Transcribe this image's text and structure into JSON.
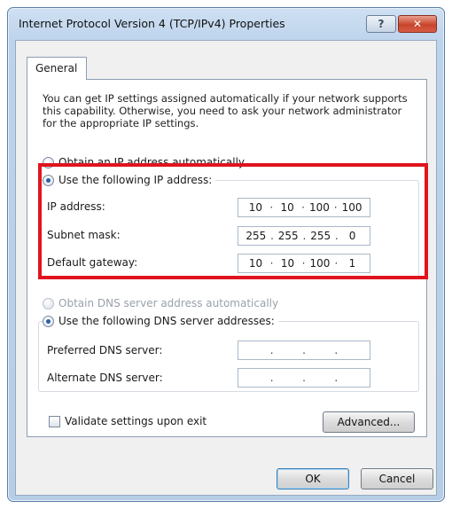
{
  "window": {
    "title": "Internet Protocol Version 4 (TCP/IPv4) Properties",
    "help_label": "?",
    "close_label": "✕"
  },
  "tabs": [
    {
      "label": "General",
      "selected": true
    }
  ],
  "intro_text": "You can get IP settings assigned automatically if your network supports this capability. Otherwise, you need to ask your network administrator for the appropriate IP settings.",
  "ip_section": {
    "auto_label": "Obtain an IP address automatically",
    "manual_label": "Use the following IP address:",
    "selected": "manual",
    "fields": [
      {
        "label": "IP address:",
        "octets": [
          "10",
          "10",
          "100",
          "100"
        ],
        "sep": [
          "·",
          "·",
          "·"
        ]
      },
      {
        "label": "Subnet mask:",
        "octets": [
          "255",
          "255",
          "255",
          "0"
        ],
        "sep": [
          ".",
          ".",
          "."
        ]
      },
      {
        "label": "Default gateway:",
        "octets": [
          "10",
          "10",
          "100",
          "1"
        ],
        "sep": [
          "·",
          "·",
          "·"
        ]
      }
    ]
  },
  "dns_section": {
    "auto_label": "Obtain DNS server address automatically",
    "manual_label": "Use the following DNS server addresses:",
    "selected": "manual",
    "fields": [
      {
        "label": "Preferred DNS server:",
        "octets": [
          "",
          "",
          "",
          ""
        ],
        "sep": [
          ".",
          ".",
          "."
        ]
      },
      {
        "label": "Alternate DNS server:",
        "octets": [
          "",
          "",
          "",
          ""
        ],
        "sep": [
          ".",
          ".",
          "."
        ]
      }
    ]
  },
  "validate_label": "Validate settings upon exit",
  "validate_checked": false,
  "buttons": {
    "advanced": "Advanced...",
    "ok": "OK",
    "cancel": "Cancel"
  },
  "colors": {
    "highlight_border": "#e0141e",
    "accent": "#2a5fa8"
  }
}
